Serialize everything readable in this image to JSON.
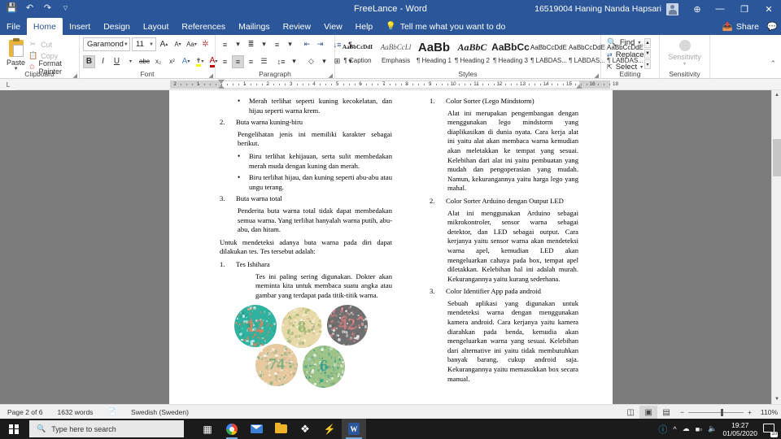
{
  "titlebar": {
    "document_title": "FreeLance  -  Word",
    "user_name": "16519004 Haning Nanda Hapsari",
    "quick_access": [
      "save-icon",
      "undo-icon",
      "redo-icon",
      "customize-icon"
    ],
    "window_buttons": {
      "minimize": "—",
      "maximize": "❐",
      "close": "✕"
    },
    "ribbon_display_icon": "⬆"
  },
  "tabs": [
    {
      "label": "File",
      "active": false
    },
    {
      "label": "Home",
      "active": true
    },
    {
      "label": "Insert",
      "active": false
    },
    {
      "label": "Design",
      "active": false
    },
    {
      "label": "Layout",
      "active": false
    },
    {
      "label": "References",
      "active": false
    },
    {
      "label": "Mailings",
      "active": false
    },
    {
      "label": "Review",
      "active": false
    },
    {
      "label": "View",
      "active": false
    },
    {
      "label": "Help",
      "active": false
    }
  ],
  "tell_me": {
    "placeholder": "Tell me what you want to do"
  },
  "share": {
    "label": "Share",
    "comments_icon": "comment-icon"
  },
  "ribbon": {
    "clipboard": {
      "group_label": "Clipboard",
      "paste_label": "Paste",
      "cut_label": "Cut",
      "copy_label": "Copy",
      "format_painter_label": "Format Painter"
    },
    "font": {
      "group_label": "Font",
      "font_name": "Garamond",
      "font_size": "11",
      "grow_label": "A",
      "shrink_label": "A",
      "change_case_label": "Aa",
      "clear_format_label": "✐",
      "bold_label": "B",
      "italic_label": "I",
      "underline_label": "U",
      "strikethrough_label": "abc",
      "subscript_label": "x₂",
      "superscript_label": "x²",
      "text_effects_label": "A",
      "highlight_label": "✐",
      "font_color_label": "A"
    },
    "paragraph": {
      "group_label": "Paragraph",
      "bullets_label": "≡",
      "numbering_label": "≡",
      "multilevel_label": "≡",
      "decrease_indent_label": "←",
      "increase_indent_label": "→",
      "sort_label": "↓",
      "show_marks_label": "¶",
      "align_left_label": "≡",
      "align_center_label": "≡",
      "align_right_label": "≡",
      "justify_label": "≡",
      "line_spacing_label": "↕",
      "shading_label": "◇",
      "borders_label": "⊞"
    },
    "styles": {
      "group_label": "Styles",
      "items": [
        {
          "preview": "AaBbCcDdI",
          "name": "¶ Caption",
          "style": "caption"
        },
        {
          "preview": "AaBbCcLl",
          "name": "Emphasis",
          "style": "emphasis"
        },
        {
          "preview": "AaBb",
          "name": "¶ Heading 1",
          "style": "h1"
        },
        {
          "preview": "AaBbC",
          "name": "¶ Heading 2",
          "style": "h2"
        },
        {
          "preview": "AaBbCc",
          "name": "¶ Heading 3",
          "style": "h3"
        },
        {
          "preview": "AaBbCcDdE",
          "name": "¶ LABDAS...",
          "style": "lab"
        },
        {
          "preview": "AaBbCcDdE",
          "name": "¶ LABDAS...",
          "style": "lab"
        },
        {
          "preview": "AaBbCcDdE",
          "name": "¶ LABDAS...",
          "style": "lab"
        }
      ]
    },
    "editing": {
      "group_label": "Editing",
      "find_label": "Find",
      "replace_label": "Replace",
      "select_label": "Select"
    },
    "sensitivity": {
      "group_label": "Sensitivity",
      "button_label": "Sensitivity"
    },
    "collapse_icon": "⌃"
  },
  "ruler": {
    "corner_label": "L",
    "left_marks": [
      "2",
      "1"
    ],
    "marks": [
      "1",
      "2",
      "3",
      "4",
      "5",
      "6",
      "7",
      "8",
      "9",
      "10",
      "11",
      "12",
      "13",
      "14",
      "15",
      "16",
      "18"
    ]
  },
  "document": {
    "left_column": [
      {
        "type": "bullet",
        "text": "Merah terlihat seperti kuning kecokelatan, dan hijau seperti warna krem."
      },
      {
        "type": "numbered",
        "num": "2.",
        "text": "Buta warna kuning-biru"
      },
      {
        "type": "para",
        "indent": 22,
        "text": "Pengelihatan jenis ini memiliki karakter sebagai berikut."
      },
      {
        "type": "bullet",
        "text": "Biru terlihat kehijauan, serta sulit membedakan merah muda dengan kuning dan merah."
      },
      {
        "type": "bullet",
        "text": "Biru terlihat hijau, dan kuning seperti abu-abu atau ungu terang."
      },
      {
        "type": "numbered",
        "num": "3.",
        "text": "Buta warna total"
      },
      {
        "type": "para",
        "indent": 22,
        "text": "Penderita buta warna total tidak dapat membedakan semua warna. Yang terlihat hanyalah warna putih, abu-abu, dan hitam."
      },
      {
        "type": "para",
        "indent": 0,
        "text": "Untuk mendeteksi adanya buta warna pada diri dapat dilakukan tes. Tes tersebut adalah:"
      },
      {
        "type": "numbered",
        "num": "1.",
        "text": "Tes Ishihara"
      },
      {
        "type": "para",
        "indent": 44,
        "text": "Tes ini paling sering digunakan. Dokter akan meminta kita untuk membaca suatu angka atau gambar yang terdapat pada titik-titik warna."
      }
    ],
    "right_column": [
      {
        "type": "numbered",
        "num": "1.",
        "text": "Color Sorter (Lego Mindstorm)"
      },
      {
        "type": "para",
        "indent": 22,
        "text": "Alat ini merupakan pengembangan dengan menggunakan lego mindstorm yang diaplikasikan di dunia nyata. Cara kerja alat ini yaitu alat akan membaca warna kemudian akan meletakkan ke tempat yang sesuai. Kelebihan dari alat ini yaitu pembuatan yang mudah dan pengoperasian yang mudah. Namun, kekurangannya yaitu harga lego yang mahal."
      },
      {
        "type": "numbered",
        "num": "2.",
        "text": "Color Sorter Arduino dengan Output LED"
      },
      {
        "type": "para",
        "indent": 22,
        "text": "Alat ini menggunakan Arduino sebagai mikrokontroler, sensor warna sebagai detektor, dan LED sebagai output. Cara kerjanya yaitu sensor warna akan mendeteksi warna apel, kemudian LED akan mengeluarkan cahaya pada box, tempat apel diletakkan. Kelebihan hal ini adalah murah. Kekurangannya yaitu kurang sederhana."
      },
      {
        "type": "numbered",
        "num": "3.",
        "text": "Color Identifier App pada android"
      },
      {
        "type": "para",
        "indent": 22,
        "text": "Sebuah aplikasi yang digunakan untuk mendeteksi warna dengan menggunakan kamera android. Cara kerjanya yaitu kamera diarahkan pada benda, kemudia akan mengeluarkan warna yang sesuai. Kelebihan dari alternative ini yaitu tidak membutuhkan banyak barang, cukup android saja. Kekurangannya yaitu memasukkan box secara manual."
      }
    ],
    "image": {
      "name": "ishihara-test-plates",
      "plates": [
        {
          "digits": "12",
          "bg": "#2fb3a0",
          "fg": "#e0825a"
        },
        {
          "digits": "8",
          "bg": "#e8d9a8",
          "fg": "#8fb36a"
        },
        {
          "digits": "42",
          "bg": "#6f6f6f",
          "fg": "#d98080"
        },
        {
          "digits": "74",
          "bg": "#e7c9a0",
          "fg": "#6fae7e"
        },
        {
          "digits": "6",
          "bg": "#9fc48a",
          "fg": "#2f9e8f"
        }
      ]
    }
  },
  "status_bar": {
    "page_label": "Page 2 of 6",
    "words_label": "1632 words",
    "proofing_icon": "proofing-errors-icon",
    "language_label": "Swedish (Sweden)",
    "views": [
      {
        "name": "read-mode",
        "icon": "◫",
        "active": false
      },
      {
        "name": "print-layout",
        "icon": "▣",
        "active": true
      },
      {
        "name": "web-layout",
        "icon": "▤",
        "active": false
      }
    ],
    "zoom_out": "−",
    "zoom_in": "+",
    "zoom_level": "110%"
  },
  "taskbar": {
    "search_placeholder": "Type here to search",
    "items": [
      {
        "name": "task-view-icon",
        "glyph": "▟"
      },
      {
        "name": "chrome-icon",
        "glyph": ""
      },
      {
        "name": "mail-icon",
        "glyph": ""
      },
      {
        "name": "file-explorer-icon",
        "glyph": ""
      },
      {
        "name": "dropbox-icon",
        "glyph": "❖"
      },
      {
        "name": "lightshot-icon",
        "glyph": "⚡"
      },
      {
        "name": "word-icon",
        "glyph": "W"
      }
    ],
    "tray": {
      "security_icon": "❓",
      "show_hidden_icon": "⌃",
      "onedrive_icon": "☁",
      "battery_icon": "▣",
      "volume_icon": "ᴘ",
      "time": "19:27",
      "date": "01/05/2020",
      "notification_count": "10"
    }
  }
}
